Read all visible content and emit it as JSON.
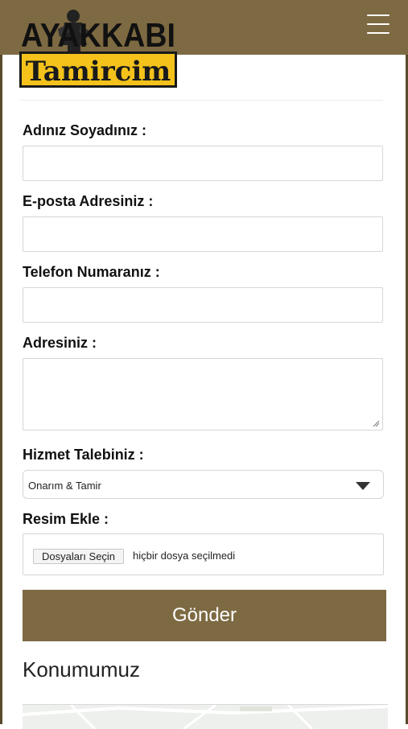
{
  "header": {
    "logo_top": "AYAKKABI",
    "logo_bottom": "Tamircim",
    "menu_icon": "hamburger-menu-icon"
  },
  "form": {
    "name_label": "Adınız Soyadınız :",
    "email_label": "E-posta Adresiniz :",
    "phone_label": "Telefon Numaranız :",
    "address_label": "Adresiniz :",
    "service_label": "Hizmet Talebiniz :",
    "service_value": "Onarım & Tamir",
    "image_label": "Resim Ekle :",
    "file_button": "Dosyaları Seçin",
    "file_status": "hiçbir dosya seçilmedi",
    "submit_label": "Gönder"
  },
  "location": {
    "title": "Konumumuz"
  },
  "colors": {
    "brand": "#7d6a42",
    "logo_yellow": "#f4c21b"
  }
}
